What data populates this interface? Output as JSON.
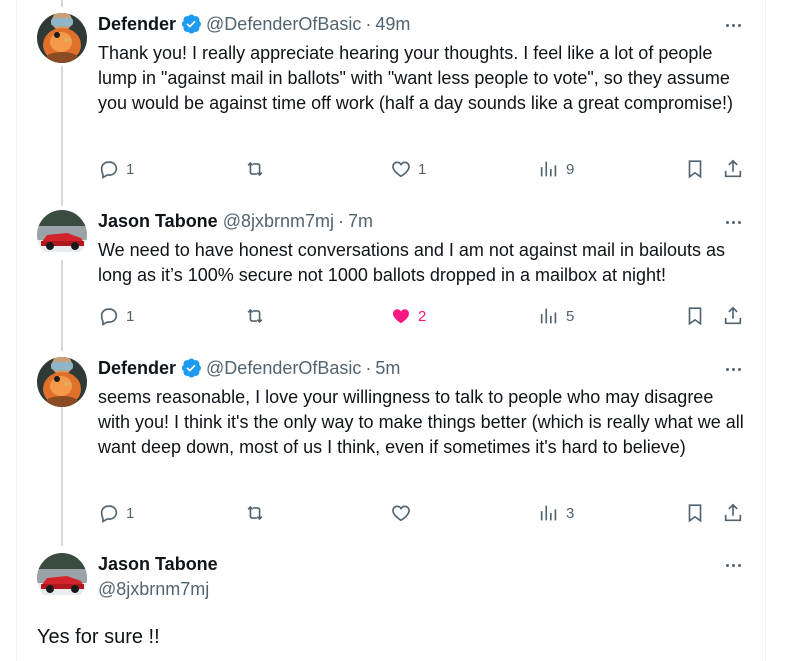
{
  "tweets": [
    {
      "name": "Defender",
      "verified": true,
      "handle": "@DefenderOfBasic",
      "sep": "·",
      "time": "49m",
      "text": "Thank you! I really appreciate hearing your thoughts. I feel like a lot of people lump in \"against mail in ballots\" with \"want less people to vote\", so they assume you would be against time off work (half a day sounds like a great compromise!)",
      "replies": "1",
      "retweets": "",
      "likes": "1",
      "views": "9"
    },
    {
      "name": "Jason Tabone",
      "handle": "@8jxbrnm7mj",
      "sep": "·",
      "time": "7m",
      "text": "We need to have honest conversations and I am not against mail in bailouts as long as it’s 100% secure not 1000 ballots dropped in a mailbox at night!",
      "replies": "1",
      "retweets": "",
      "likes": "2",
      "liked": true,
      "views": "5"
    },
    {
      "name": "Defender",
      "verified": true,
      "handle": "@DefenderOfBasic",
      "sep": "·",
      "time": "5m",
      "text": "seems reasonable, I love your willingness to talk to people who may disagree with you! I think it's the only way to make things better (which is really what we all want deep down, most of us I think, even if sometimes it's hard to believe)",
      "replies": "1",
      "retweets": "",
      "likes": "",
      "views": "3"
    }
  ],
  "main_tweet": {
    "name": "Jason Tabone",
    "handle": "@8jxbrnm7mj",
    "text": "Yes for sure !!"
  },
  "colors": {
    "accent": "#1d9bf0",
    "like": "#f91880",
    "secondary_text": "#536471",
    "thread_line": "#cfd9de"
  },
  "icons": {
    "reply": "speech-bubble-icon",
    "retweet": "retweet-arrows-icon",
    "like": "heart-icon",
    "views": "bar-chart-icon",
    "bookmark": "bookmark-icon",
    "share": "share-upload-icon",
    "more": "ellipsis-icon",
    "verified": "verified-badge-icon"
  }
}
